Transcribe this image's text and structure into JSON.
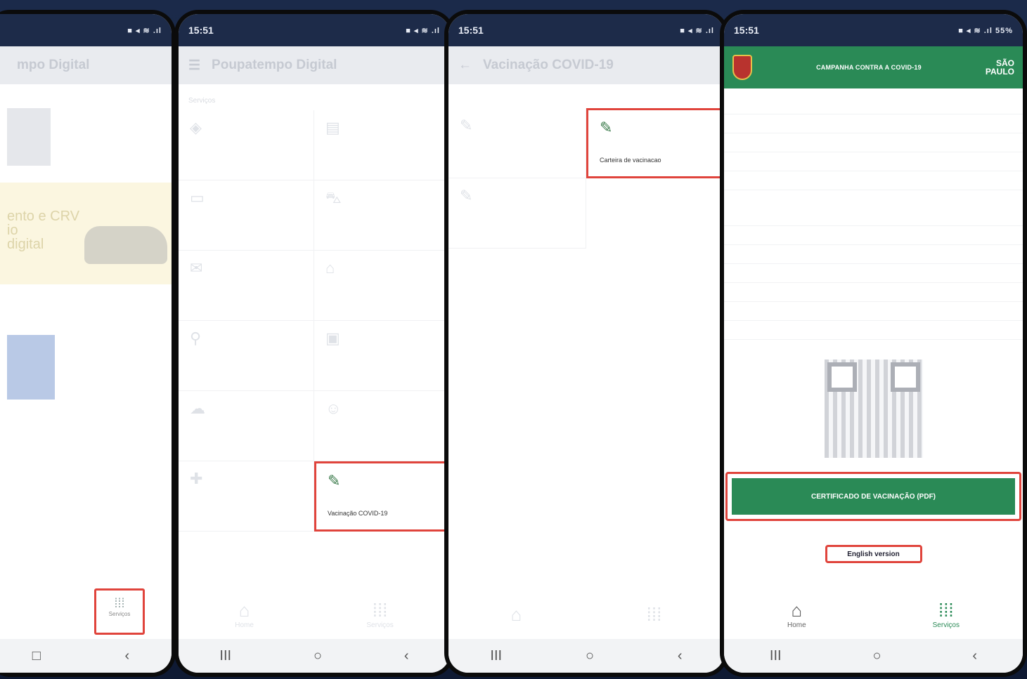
{
  "phone1": {
    "app_title": "mpo Digital",
    "banner_lines": [
      "ento e CRV",
      "io",
      "digital"
    ],
    "services_label": "Serviços"
  },
  "phone2": {
    "time": "15:51",
    "app_title": "Poupatempo Digital",
    "section": "Serviços",
    "highlight_label": "Vacinação COVID-19",
    "nav_home": "Home",
    "nav_services": "Serviços"
  },
  "phone3": {
    "time": "15:51",
    "app_title": "Vacinação COVID-19",
    "highlight_label": "Carteira de vacinacao"
  },
  "phone4": {
    "time": "15:51",
    "battery": "55%",
    "header_title": "CAMPANHA CONTRA A COVID-19",
    "logo_line1": "SÃO",
    "logo_line2": "PAULO",
    "cert_button": "CERTIFICADO DE VACINAÇÃO (PDF)",
    "english_button": "English version",
    "nav_home": "Home",
    "nav_services": "Serviços"
  },
  "icons": {
    "menu": "☰",
    "back": "←",
    "vaccine": "💉",
    "home": "⌂",
    "apps": "⋮⋮⋮",
    "recents": "III",
    "circle": "○",
    "chevron": "‹"
  },
  "colors": {
    "statusbar": "#1d2b49",
    "gov_green": "#2a8a56",
    "highlight_red": "#e0443c"
  }
}
